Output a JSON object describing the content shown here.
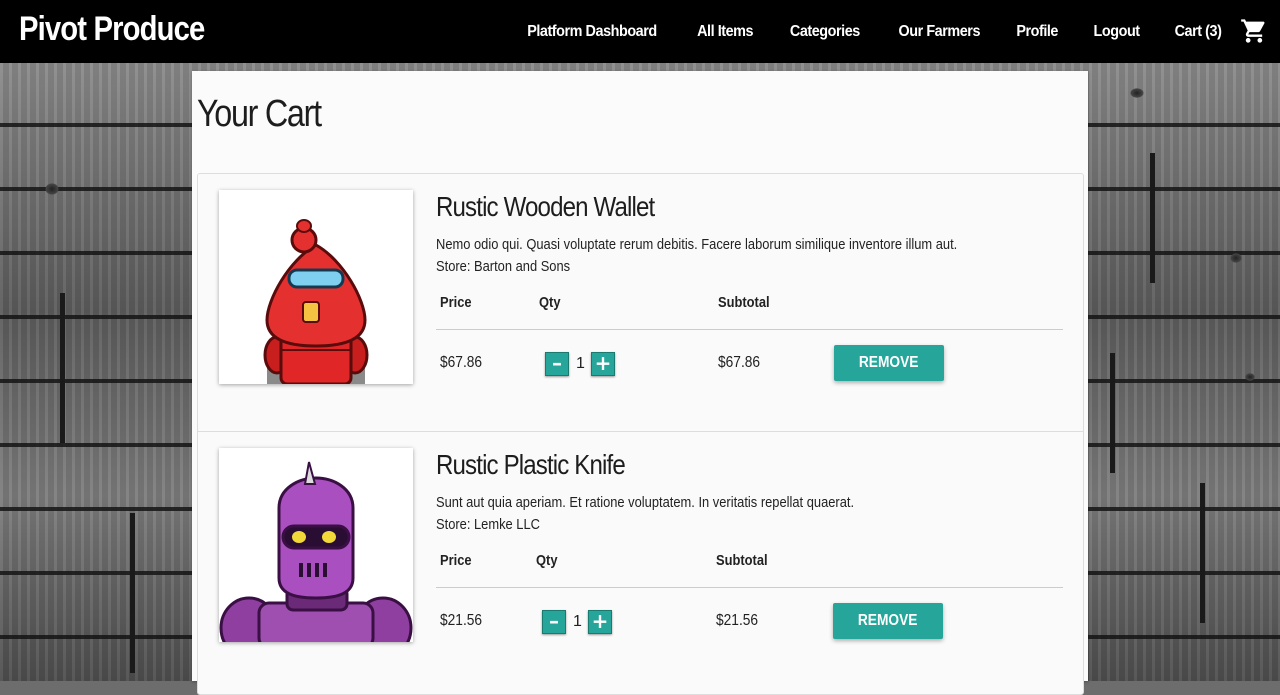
{
  "navbar": {
    "brand": "Pivot Produce",
    "links": [
      "Platform Dashboard",
      "All Items",
      "Categories",
      "Our Farmers",
      "Profile",
      "Logout",
      "Cart (3)"
    ],
    "cart_icon": "shopping-cart-icon"
  },
  "page": {
    "title": "Your Cart"
  },
  "cart": {
    "headers": {
      "price": "Price",
      "qty": "Qty",
      "subtotal": "Subtotal"
    },
    "remove_label": "REMOVE",
    "minus_label": "–",
    "plus_label": "+",
    "items": [
      {
        "name": "Rustic Wooden Wallet",
        "description": "Nemo odio qui. Quasi voluptate rerum debitis. Facere laborum similique inventore illum aut.",
        "store": "Store: Barton and Sons",
        "price": "$67.86",
        "qty": "1",
        "subtotal": "$67.86",
        "image": "red-robot-illustration"
      },
      {
        "name": "Rustic Plastic Knife",
        "description": "Sunt aut quia aperiam. Et ratione voluptatem. In veritatis repellat quaerat.",
        "store": "Store: Lemke LLC",
        "price": "$21.56",
        "qty": "1",
        "subtotal": "$21.56",
        "image": "purple-robot-illustration"
      }
    ]
  },
  "colors": {
    "accent": "#26a69a",
    "navbar": "#000000"
  }
}
